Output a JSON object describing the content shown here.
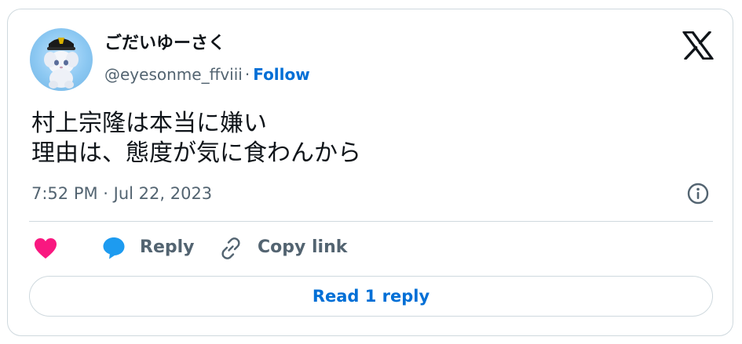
{
  "author": {
    "display_name": "ごだいゆーさく",
    "handle": "@eyesonme_ffviii",
    "separator": "·",
    "follow_label": "Follow"
  },
  "tweet": {
    "lines": [
      "村上宗隆は本当に嫌い",
      "理由は、態度が気に食わんから"
    ],
    "timestamp": "7:52 PM · Jul 22, 2023"
  },
  "actions": {
    "reply_label": "Reply",
    "copy_link_label": "Copy link",
    "read_replies_label": "Read 1 reply"
  },
  "icons": {
    "brand": "x-logo-icon",
    "info": "info-icon",
    "like": "heart-icon",
    "reply": "reply-bubble-icon",
    "copy": "link-icon"
  },
  "colors": {
    "link_blue": "#006fd6",
    "heart_pink": "#f91880",
    "reply_blue": "#1d9bf0",
    "muted_text": "#536471",
    "border": "#cfd9de"
  }
}
